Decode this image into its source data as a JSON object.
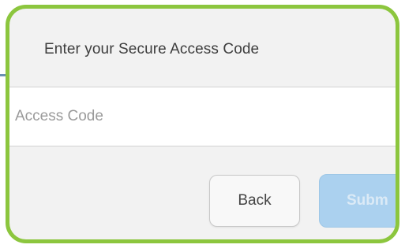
{
  "dialog": {
    "title": "Enter your Secure Access Code",
    "access_code_placeholder": "Access Code",
    "access_code_value": "",
    "back_label": "Back",
    "submit_label": "Subm"
  },
  "colors": {
    "callout_border": "#8cc63e",
    "dialog_background": "#f2f2f2",
    "submit_background": "#abd1ef",
    "underlying_line": "#6a90b4"
  }
}
